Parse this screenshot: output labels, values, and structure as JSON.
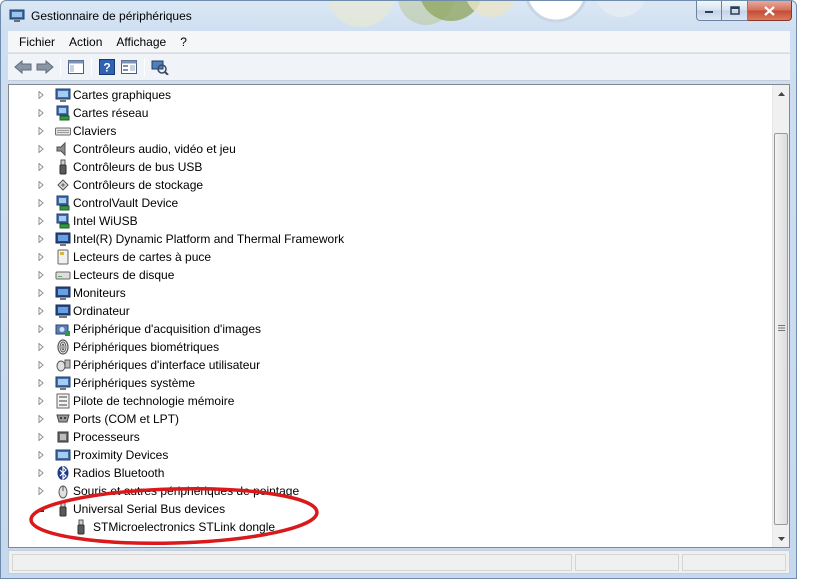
{
  "window": {
    "title": "Gestionnaire de périphériques"
  },
  "menu": {
    "items": [
      {
        "label": "Fichier"
      },
      {
        "label": "Action"
      },
      {
        "label": "Affichage"
      },
      {
        "label": "?"
      }
    ]
  },
  "toolbar": {
    "buttons": [
      "back-icon",
      "forward-icon",
      "show-hide-tree-icon",
      "help-icon",
      "properties-icon",
      "scan-hardware-icon"
    ]
  },
  "tree": {
    "items": [
      {
        "label": "Cartes graphiques",
        "icon": "display-adapter-icon",
        "expanded": false
      },
      {
        "label": "Cartes réseau",
        "icon": "network-adapter-icon",
        "expanded": false
      },
      {
        "label": "Claviers",
        "icon": "keyboard-icon",
        "expanded": false
      },
      {
        "label": "Contrôleurs audio, vidéo et jeu",
        "icon": "speaker-icon",
        "expanded": false
      },
      {
        "label": "Contrôleurs de bus USB",
        "icon": "usb-icon",
        "expanded": false
      },
      {
        "label": "Contrôleurs de stockage",
        "icon": "storage-controller-icon",
        "expanded": false
      },
      {
        "label": "ControlVault Device",
        "icon": "network-device-icon",
        "expanded": false
      },
      {
        "label": "Intel WiUSB",
        "icon": "network-device-icon",
        "expanded": false
      },
      {
        "label": "Intel(R) Dynamic Platform and Thermal Framework",
        "icon": "monitor-icon",
        "expanded": false
      },
      {
        "label": "Lecteurs de cartes à puce",
        "icon": "smartcard-icon",
        "expanded": false
      },
      {
        "label": "Lecteurs de disque",
        "icon": "disk-drive-icon",
        "expanded": false
      },
      {
        "label": "Moniteurs",
        "icon": "monitor-icon",
        "expanded": false
      },
      {
        "label": "Ordinateur",
        "icon": "computer-icon",
        "expanded": false
      },
      {
        "label": "Périphérique d'acquisition d'images",
        "icon": "camera-icon",
        "expanded": false
      },
      {
        "label": "Périphériques biométriques",
        "icon": "fingerprint-icon",
        "expanded": false
      },
      {
        "label": "Périphériques d'interface utilisateur",
        "icon": "hid-icon",
        "expanded": false
      },
      {
        "label": "Périphériques système",
        "icon": "system-device-icon",
        "expanded": false
      },
      {
        "label": "Pilote de technologie mémoire",
        "icon": "memory-icon",
        "expanded": false
      },
      {
        "label": "Ports (COM et LPT)",
        "icon": "port-icon",
        "expanded": false
      },
      {
        "label": "Processeurs",
        "icon": "processor-icon",
        "expanded": false
      },
      {
        "label": "Proximity Devices",
        "icon": "proximity-icon",
        "expanded": false
      },
      {
        "label": "Radios Bluetooth",
        "icon": "bluetooth-icon",
        "expanded": false
      },
      {
        "label": "Souris et autres périphériques de pointage",
        "icon": "mouse-icon",
        "expanded": false
      },
      {
        "label": "Universal Serial Bus devices",
        "icon": "usb-icon",
        "expanded": true
      }
    ],
    "child": {
      "label": "STMicroelectronics STLink dongle",
      "icon": "usb-icon"
    }
  },
  "colors": {
    "annotation": "#d9191c",
    "frame": "#c5d8ee",
    "tree_bg": "#ffffff"
  }
}
